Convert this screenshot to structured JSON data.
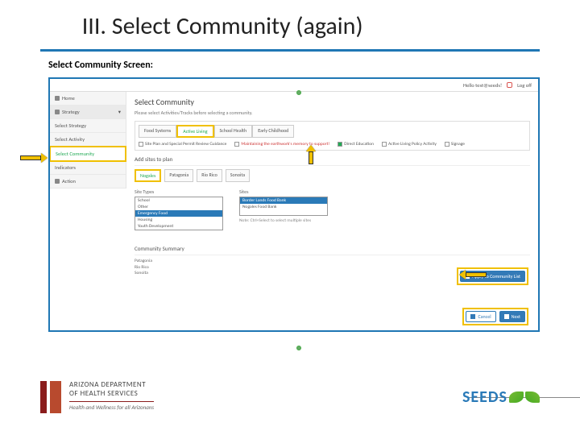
{
  "title_num": "III.",
  "title_text": "Select Community (again)",
  "subtitle": "Select Community Screen:",
  "topbar": {
    "hello": "Hello test@seeds!",
    "logoff": "Log off"
  },
  "sidebar": {
    "items": [
      {
        "label": "Home"
      },
      {
        "label": "Strategy"
      },
      {
        "label": "Select Strategy"
      },
      {
        "label": "Select Activity"
      },
      {
        "label": "Select Community"
      },
      {
        "label": "Indicators"
      },
      {
        "label": "Action"
      }
    ]
  },
  "main": {
    "heading": "Select Community",
    "instruction": "Please select Activities/Tracks before selecting a community.",
    "tabs": [
      "Food Systems",
      "Active Living",
      "School Health",
      "Early Childhood"
    ],
    "tab_selected": 1,
    "checks": [
      {
        "label": "Site Plan and Special Permit Review Guidance",
        "checked": false,
        "bad": false
      },
      {
        "label": "Maintaining the earthwork's memory to support!",
        "checked": false,
        "bad": true
      },
      {
        "label": "Direct Education",
        "checked": true,
        "bad": false
      },
      {
        "label": "Active Living Policy Activity",
        "checked": false,
        "bad": false
      },
      {
        "label": "Signage",
        "checked": false,
        "bad": false
      }
    ],
    "add_sites": "Add sites to plan",
    "cities": [
      "Nogales",
      "Patagonia",
      "Rio Rico",
      "Sonoita"
    ],
    "city_selected": 0,
    "site_types_label": "Site Types",
    "site_types": [
      "School",
      "Other",
      "Emergency Food",
      "Housing",
      "Youth Development"
    ],
    "site_types_selected": 2,
    "sites_label": "Sites",
    "sites": [
      "Border Lands Food Bank",
      "Nogales Food Bank"
    ],
    "sites_selected": 0,
    "sites_hint": "Note: Ctrl+Select to select multiple sites",
    "apply_btn": "Apply to Community List",
    "summary_label": "Community Summary",
    "summary_items": [
      "Patagonia",
      "Rio Rico",
      "Sonoita"
    ],
    "cancel": "Cancel",
    "next": "Next"
  },
  "footer": {
    "adhs1": "ARIZONA DEPARTMENT",
    "adhs2": "OF HEALTH SERVICES",
    "tag": "Health and Wellness for all Arizonans",
    "seeds": "SEEDS"
  }
}
